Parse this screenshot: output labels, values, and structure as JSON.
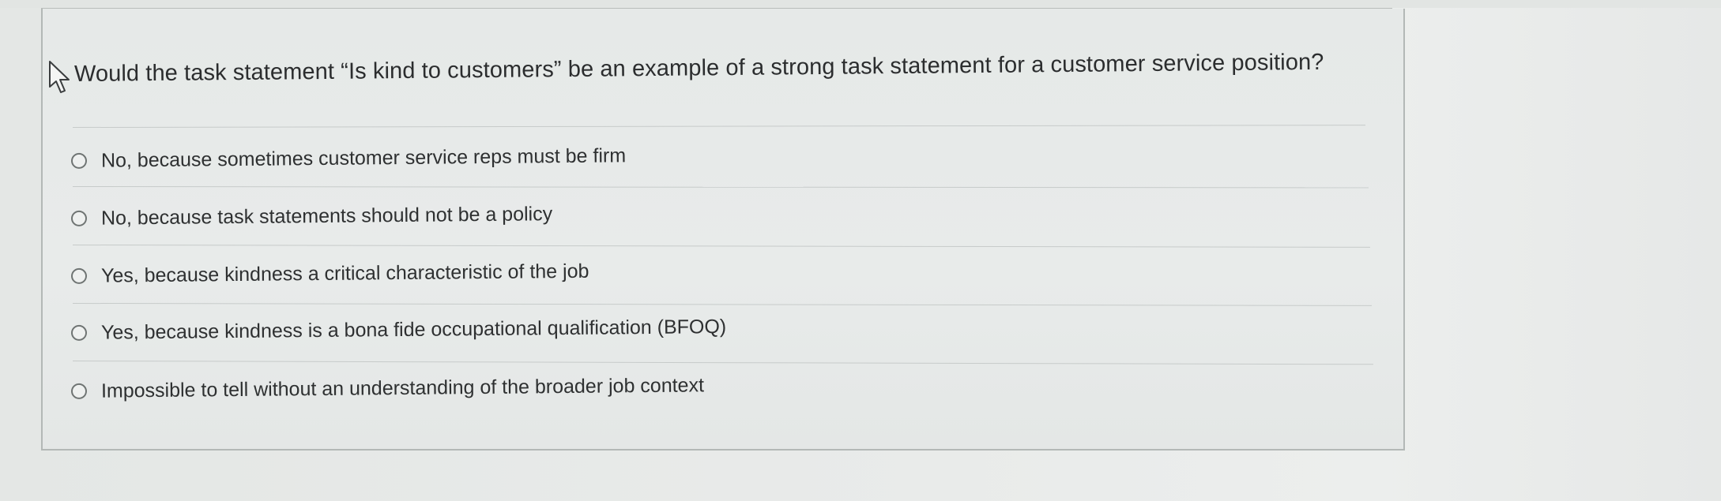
{
  "question": {
    "text": "Would the task statement “Is kind to customers” be an example of a strong task statement for a customer service position?"
  },
  "options": [
    {
      "label": "No, because sometimes customer service reps must be firm",
      "selected": false
    },
    {
      "label": "No, because task statements should not be a policy",
      "selected": false
    },
    {
      "label": "Yes, because kindness a critical characteristic of the job",
      "selected": false
    },
    {
      "label": "Yes, because kindness is a bona fide occupational qualification (BFOQ)",
      "selected": false
    },
    {
      "label": "Impossible to tell without an understanding of the broader job context",
      "selected": false
    }
  ],
  "icons": {
    "cursor": "mouse-pointer-icon",
    "radio": "radio-button-unselected-icon"
  },
  "colors": {
    "background": "#e8ebea",
    "text": "#2b2d2e",
    "border": "#b3b8b6",
    "radio_border": "#6f7473"
  }
}
